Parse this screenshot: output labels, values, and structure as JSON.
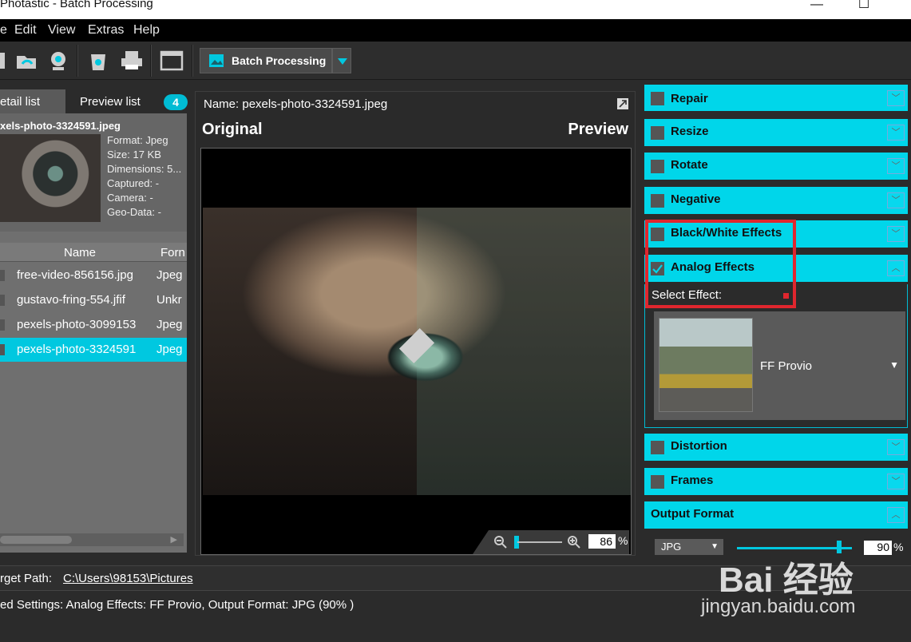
{
  "window": {
    "title": "Photastic - Batch Processing",
    "minimize": "—",
    "maximize": "☐"
  },
  "menu": {
    "edit": "Edit",
    "view": "View",
    "extras": "Extras",
    "help": "Help",
    "file_partial": "e"
  },
  "toolbar": {
    "batch_label": "Batch Processing"
  },
  "left": {
    "tab_detail": "etail list",
    "tab_preview": "Preview list",
    "count": "4",
    "file_name": "xels-photo-3324591.jpeg",
    "format": "Format: Jpeg",
    "size": "Size: 17 KB",
    "dimensions": "Dimensions: 5...",
    "captured": "Captured: -",
    "camera": "Camera: -",
    "geo": "Geo-Data: -",
    "col_name": "Name",
    "col_format": "Forn",
    "rows": [
      {
        "name": "free-video-856156.jpg",
        "format": "Jpeg"
      },
      {
        "name": "gustavo-fring-554.jfif",
        "format": "Unkr"
      },
      {
        "name": "pexels-photo-3099153",
        "format": "Jpeg"
      },
      {
        "name": "pexels-photo-3324591",
        "format": "Jpeg"
      }
    ]
  },
  "center": {
    "name": "Name: pexels-photo-3324591.jpeg",
    "original": "Original",
    "preview": "Preview",
    "zoom": "86",
    "zoom_unit": "%"
  },
  "right": {
    "sections": {
      "repair": "Repair",
      "resize": "Resize",
      "rotate": "Rotate",
      "negative": "Negative",
      "bw": "Black/White Effects",
      "analog": "Analog Effects",
      "distortion": "Distortion",
      "frames": "Frames",
      "output": "Output Format"
    },
    "select_effect": "Select Effect:",
    "effect_name": "FF Provio",
    "output_format": "JPG",
    "quality": "90",
    "quality_unit": "%",
    "analog_checked": true
  },
  "bottom": {
    "target_label": "rget Path:",
    "target_value": "C:\\Users\\98153\\Pictures",
    "settings_text": "ed Settings: Analog Effects: FF Provio, Output Format: JPG (90% )"
  },
  "watermark": {
    "brand": "Bai 经验",
    "url": "jingyan.baidu.com"
  },
  "colors": {
    "accent": "#00d6ea",
    "highlight": "#e0262e",
    "background": "#2b2b2b"
  }
}
